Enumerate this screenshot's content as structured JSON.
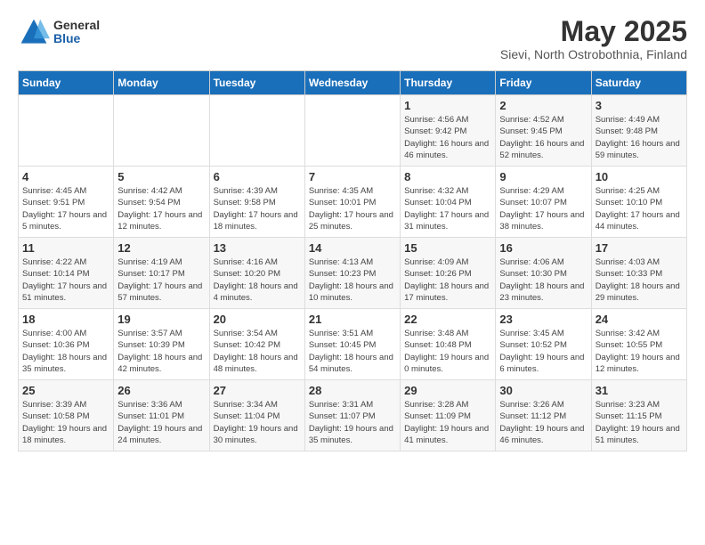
{
  "header": {
    "logo_general": "General",
    "logo_blue": "Blue",
    "title": "May 2025",
    "subtitle": "Sievi, North Ostrobothnia, Finland"
  },
  "days_header": [
    "Sunday",
    "Monday",
    "Tuesday",
    "Wednesday",
    "Thursday",
    "Friday",
    "Saturday"
  ],
  "weeks": [
    [
      {
        "day": "",
        "content": ""
      },
      {
        "day": "",
        "content": ""
      },
      {
        "day": "",
        "content": ""
      },
      {
        "day": "",
        "content": ""
      },
      {
        "day": "1",
        "content": "Sunrise: 4:56 AM\nSunset: 9:42 PM\nDaylight: 16 hours\nand 46 minutes."
      },
      {
        "day": "2",
        "content": "Sunrise: 4:52 AM\nSunset: 9:45 PM\nDaylight: 16 hours\nand 52 minutes."
      },
      {
        "day": "3",
        "content": "Sunrise: 4:49 AM\nSunset: 9:48 PM\nDaylight: 16 hours\nand 59 minutes."
      }
    ],
    [
      {
        "day": "4",
        "content": "Sunrise: 4:45 AM\nSunset: 9:51 PM\nDaylight: 17 hours\nand 5 minutes."
      },
      {
        "day": "5",
        "content": "Sunrise: 4:42 AM\nSunset: 9:54 PM\nDaylight: 17 hours\nand 12 minutes."
      },
      {
        "day": "6",
        "content": "Sunrise: 4:39 AM\nSunset: 9:58 PM\nDaylight: 17 hours\nand 18 minutes."
      },
      {
        "day": "7",
        "content": "Sunrise: 4:35 AM\nSunset: 10:01 PM\nDaylight: 17 hours\nand 25 minutes."
      },
      {
        "day": "8",
        "content": "Sunrise: 4:32 AM\nSunset: 10:04 PM\nDaylight: 17 hours\nand 31 minutes."
      },
      {
        "day": "9",
        "content": "Sunrise: 4:29 AM\nSunset: 10:07 PM\nDaylight: 17 hours\nand 38 minutes."
      },
      {
        "day": "10",
        "content": "Sunrise: 4:25 AM\nSunset: 10:10 PM\nDaylight: 17 hours\nand 44 minutes."
      }
    ],
    [
      {
        "day": "11",
        "content": "Sunrise: 4:22 AM\nSunset: 10:14 PM\nDaylight: 17 hours\nand 51 minutes."
      },
      {
        "day": "12",
        "content": "Sunrise: 4:19 AM\nSunset: 10:17 PM\nDaylight: 17 hours\nand 57 minutes."
      },
      {
        "day": "13",
        "content": "Sunrise: 4:16 AM\nSunset: 10:20 PM\nDaylight: 18 hours\nand 4 minutes."
      },
      {
        "day": "14",
        "content": "Sunrise: 4:13 AM\nSunset: 10:23 PM\nDaylight: 18 hours\nand 10 minutes."
      },
      {
        "day": "15",
        "content": "Sunrise: 4:09 AM\nSunset: 10:26 PM\nDaylight: 18 hours\nand 17 minutes."
      },
      {
        "day": "16",
        "content": "Sunrise: 4:06 AM\nSunset: 10:30 PM\nDaylight: 18 hours\nand 23 minutes."
      },
      {
        "day": "17",
        "content": "Sunrise: 4:03 AM\nSunset: 10:33 PM\nDaylight: 18 hours\nand 29 minutes."
      }
    ],
    [
      {
        "day": "18",
        "content": "Sunrise: 4:00 AM\nSunset: 10:36 PM\nDaylight: 18 hours\nand 35 minutes."
      },
      {
        "day": "19",
        "content": "Sunrise: 3:57 AM\nSunset: 10:39 PM\nDaylight: 18 hours\nand 42 minutes."
      },
      {
        "day": "20",
        "content": "Sunrise: 3:54 AM\nSunset: 10:42 PM\nDaylight: 18 hours\nand 48 minutes."
      },
      {
        "day": "21",
        "content": "Sunrise: 3:51 AM\nSunset: 10:45 PM\nDaylight: 18 hours\nand 54 minutes."
      },
      {
        "day": "22",
        "content": "Sunrise: 3:48 AM\nSunset: 10:48 PM\nDaylight: 19 hours\nand 0 minutes."
      },
      {
        "day": "23",
        "content": "Sunrise: 3:45 AM\nSunset: 10:52 PM\nDaylight: 19 hours\nand 6 minutes."
      },
      {
        "day": "24",
        "content": "Sunrise: 3:42 AM\nSunset: 10:55 PM\nDaylight: 19 hours\nand 12 minutes."
      }
    ],
    [
      {
        "day": "25",
        "content": "Sunrise: 3:39 AM\nSunset: 10:58 PM\nDaylight: 19 hours\nand 18 minutes."
      },
      {
        "day": "26",
        "content": "Sunrise: 3:36 AM\nSunset: 11:01 PM\nDaylight: 19 hours\nand 24 minutes."
      },
      {
        "day": "27",
        "content": "Sunrise: 3:34 AM\nSunset: 11:04 PM\nDaylight: 19 hours\nand 30 minutes."
      },
      {
        "day": "28",
        "content": "Sunrise: 3:31 AM\nSunset: 11:07 PM\nDaylight: 19 hours\nand 35 minutes."
      },
      {
        "day": "29",
        "content": "Sunrise: 3:28 AM\nSunset: 11:09 PM\nDaylight: 19 hours\nand 41 minutes."
      },
      {
        "day": "30",
        "content": "Sunrise: 3:26 AM\nSunset: 11:12 PM\nDaylight: 19 hours\nand 46 minutes."
      },
      {
        "day": "31",
        "content": "Sunrise: 3:23 AM\nSunset: 11:15 PM\nDaylight: 19 hours\nand 51 minutes."
      }
    ]
  ]
}
